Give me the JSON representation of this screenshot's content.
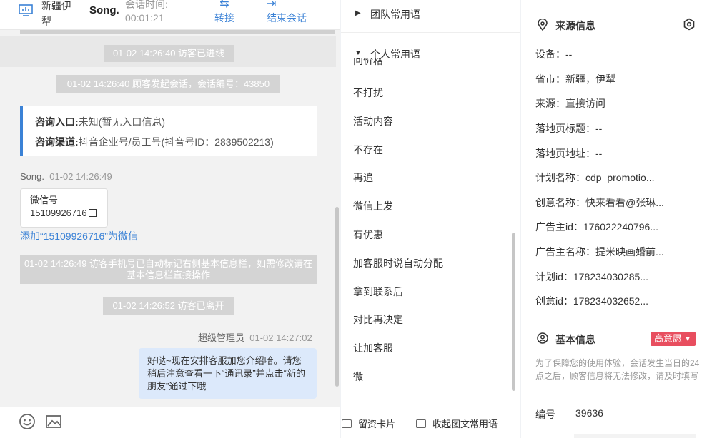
{
  "header": {
    "location": "新疆伊犁",
    "visitor_name": "Song.",
    "time_label": "会话时间:",
    "time_value": "00:01:21",
    "transfer_label": "转接",
    "end_label": "结束会话",
    "icons": [
      "monitor-icon",
      "transfer-icon",
      "exit-icon"
    ]
  },
  "chat": {
    "sys1": "01-02 14:26:40 访客已进线",
    "sys2": "01-02 14:26:40 顾客发起会话，会话编号：43850",
    "entry_label": "咨询入口:",
    "entry_value": "未知(暂无入口信息)",
    "channel_label": "咨询渠道:",
    "channel_value": "抖音企业号/员工号(抖音号ID：2839502213)",
    "visitor_name": "Song.",
    "visitor_time": "01-02 14:26:49",
    "wechat_label": "微信号",
    "wechat_value": "15109926716",
    "add_link": "添加“15109926716”为微信",
    "sys3": "01-02 14:26:49 访客手机号已自动标记右侧基本信息栏，如需修改请在基本信息栏直接操作",
    "sys4": "01-02 14:26:52 访客已离开",
    "agent_name": "超级管理员",
    "agent_time": "01-02 14:27:02",
    "agent_msg": "好哒~现在安排客服加您介绍哈。请您稍后注意查看一下“通讯录”并点击“新的朋友”通过下哦"
  },
  "footer_icons": [
    "emoji-icon",
    "image-icon"
  ],
  "phrases": {
    "team_title": "团队常用语",
    "personal_title": "个人常用语",
    "partial_item": "问价格",
    "items": [
      "不打扰",
      "活动内容",
      "不存在",
      "再追",
      "微信上发",
      "有优惠",
      "加客服时说自动分配",
      "拿到联系后",
      "对比再决定",
      "让加客服",
      "微"
    ],
    "card_btn": "留资卡片",
    "collapse_btn": "收起图文常用语"
  },
  "source": {
    "title": "来源信息",
    "rows": [
      "设备：--",
      "省市：新疆，伊犁",
      "来源：直接访问",
      "落地页标题：--",
      "落地页地址：--",
      "计划名称：cdp_promotio...",
      "创意名称：快来看看@张琳...",
      "广告主id：176022240796...",
      "广告主名称：提米映画婚前...",
      "计划id：178234030285...",
      "创意id：178234032652..."
    ]
  },
  "basic": {
    "title": "基本信息",
    "intent_tag": "高意愿",
    "note": "为了保障您的使用体验，会话发生当日的24点之后，顾客信息将无法修改，请及时填写",
    "id_label": "编号",
    "id_value": "39636"
  }
}
